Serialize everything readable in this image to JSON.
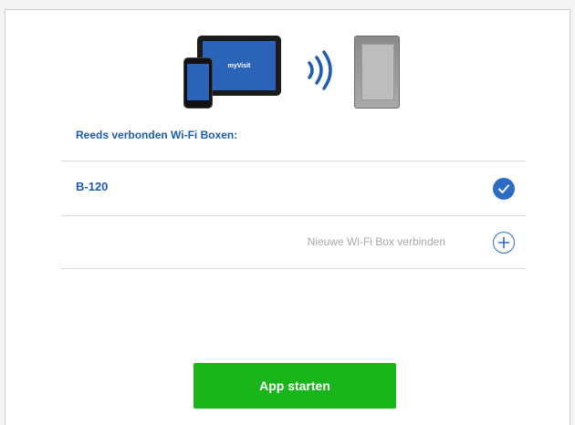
{
  "hero": {
    "tablet_brand": "myVisit",
    "icons": [
      "tablet-icon",
      "phone-icon",
      "wifi-signal-icon",
      "wifi-box-device-icon"
    ]
  },
  "connected_section": {
    "title": "Reeds verbonden Wi-Fi Boxen:"
  },
  "devices": [
    {
      "label": "B-120",
      "status_icon": "check-icon"
    }
  ],
  "add_device": {
    "label": "Nieuwe Wi-Fi Box verbinden",
    "icon": "plus-circle-icon"
  },
  "start_button": {
    "label": "App starten"
  },
  "colors": {
    "accent_blue": "#1f5bb0",
    "check_blue": "#2e6cc4",
    "button_green": "#19b51b",
    "muted_text": "#a8a8a8"
  }
}
